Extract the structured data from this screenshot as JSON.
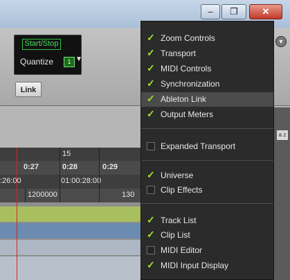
{
  "window": {
    "minimize_icon": "minimize-icon",
    "maximize_icon": "maximize-icon",
    "close_icon": "close-icon",
    "min_glyph": "–",
    "max_glyph": "❐",
    "close_glyph": "✕"
  },
  "transport": {
    "start_stop_label": "Start/Stop",
    "quantize_label": "Quantize",
    "quantize_value": "1",
    "link_label": "Link"
  },
  "ruler": {
    "bar_15": "15",
    "times": [
      "0:27",
      "0:28",
      "0:29"
    ],
    "timecodes": [
      ":26:00",
      "01:00:28:00"
    ],
    "samples": [
      "1200000",
      "130"
    ]
  },
  "az_label": "a z",
  "colors": {
    "checkmark": "#a6e22e",
    "menu_bg": "#2b2b2b",
    "hover_bg": "#4b4b4b",
    "playhead": "#e02020"
  },
  "menu": {
    "items": [
      {
        "label": "Zoom Controls",
        "checked": true
      },
      {
        "label": "Transport",
        "checked": true
      },
      {
        "label": "MIDI Controls",
        "checked": true
      },
      {
        "label": "Synchronization",
        "checked": true
      },
      {
        "label": "Ableton Link",
        "checked": true,
        "hovered": true
      },
      {
        "label": "Output Meters",
        "checked": true
      },
      {
        "label": "Expanded Transport",
        "checked": false
      },
      {
        "label": "Universe",
        "checked": true
      },
      {
        "label": "Clip Effects",
        "checked": false
      },
      {
        "label": "Track List",
        "checked": true
      },
      {
        "label": "Clip List",
        "checked": true
      },
      {
        "label": "MIDI Editor",
        "checked": false
      },
      {
        "label": "MIDI Input Display",
        "checked": true
      }
    ]
  }
}
